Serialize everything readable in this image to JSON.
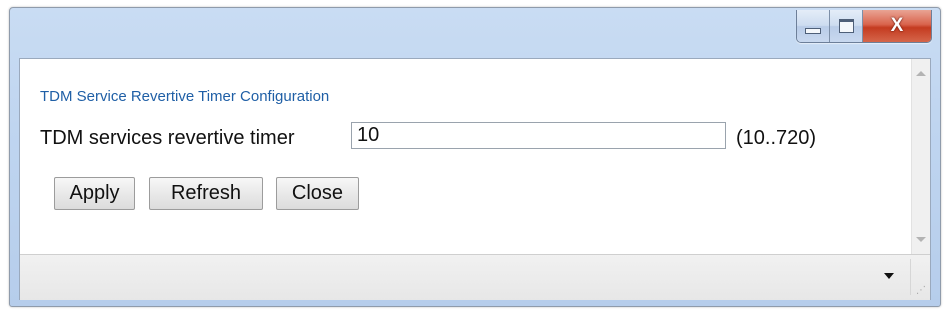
{
  "window": {
    "controls": {
      "minimize_icon": "minimize-icon",
      "maximize_icon": "maximize-icon",
      "close_icon": "close-icon",
      "close_glyph": "X",
      "close_color": "#c9452b"
    }
  },
  "dialog": {
    "section_title": "TDM Service Revertive Timer Configuration",
    "field_label": "TDM services revertive timer",
    "field_value": "10",
    "field_range": "(10..720)",
    "buttons": {
      "apply": "Apply",
      "refresh": "Refresh",
      "close": "Close"
    }
  },
  "statusbar": {
    "dropdown_icon": "dropdown-arrow-icon",
    "resize_icon": "resize-grip-icon"
  },
  "colors": {
    "title_text": "#1f5fa6",
    "frame": "#bfd5f0"
  }
}
